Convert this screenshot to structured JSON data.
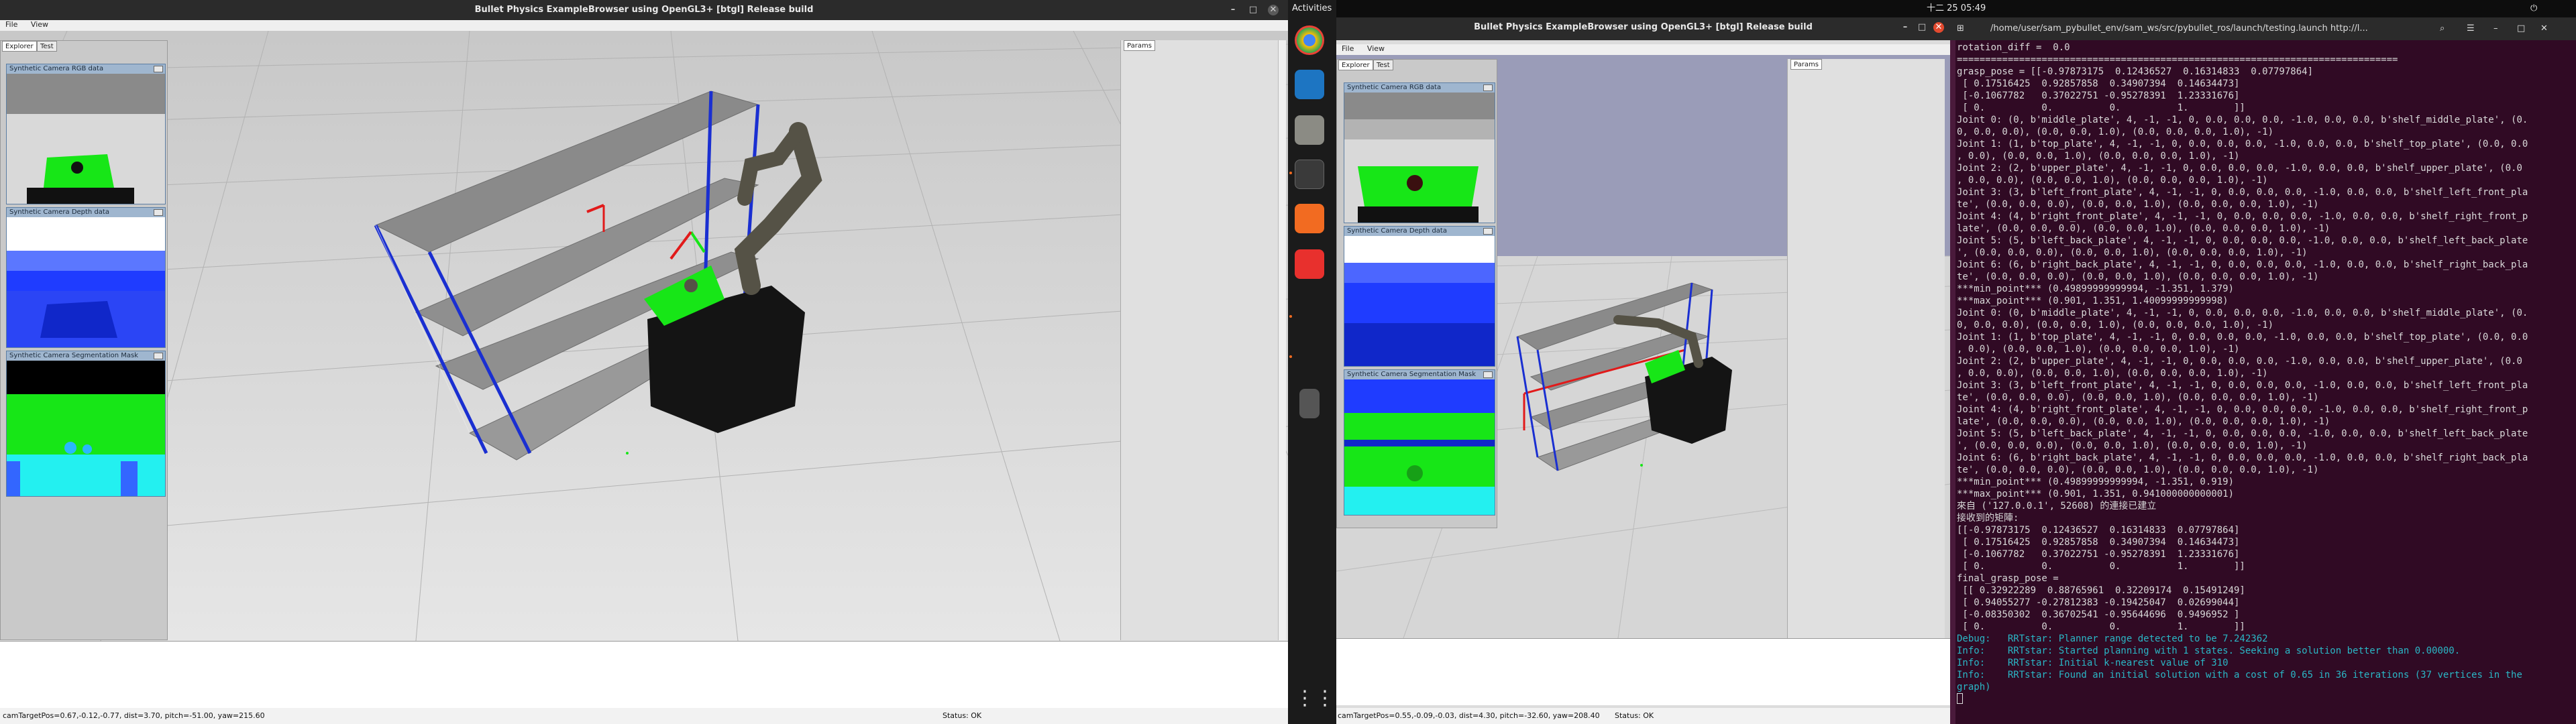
{
  "system": {
    "activities": "Activities",
    "clock": "十二 25  05:49"
  },
  "left_window": {
    "title": "Bullet Physics ExampleBrowser using OpenGL3+ [btgl] Release build",
    "menu": [
      "File",
      "View"
    ],
    "tabs": [
      "Explorer",
      "Test"
    ],
    "params_tab": "Params",
    "subwindows": [
      "Synthetic Camera RGB data",
      "Synthetic Camera Depth data",
      "Synthetic Camera Segmentation Mask"
    ],
    "status_left": "camTargetPos=0.67,-0.12,-0.77, dist=3.70, pitch=-51.00, yaw=215.60",
    "status_right": "Status: OK"
  },
  "right_window": {
    "title": "Bullet Physics ExampleBrowser using OpenGL3+ [btgl] Release build",
    "menu": [
      "File",
      "View"
    ],
    "tabs": [
      "Explorer",
      "Test"
    ],
    "params_tab": "Params",
    "subwindows": [
      "Synthetic Camera RGB data",
      "Synthetic Camera Depth data",
      "Synthetic Camera Segmentation Mask"
    ],
    "status_left": "camTargetPos=0.55,-0.09,-0.03, dist=4.30, pitch=-32.60, yaw=208.40",
    "status_right": "Status: OK"
  },
  "terminal": {
    "title": "/home/user/sam_pybullet_env/sam_ws/src/pybullet_ros/launch/testing.launch http://l...",
    "lines": [
      "rotation_diff =  0.0",
      "==============================================================================",
      "grasp_pose = [[-0.97873175  0.12436527  0.16314833  0.07797864]",
      " [ 0.17516425  0.92857858  0.34907394  0.14634473]",
      " [-0.1067782   0.37022751 -0.95278391  1.23331676]",
      " [ 0.          0.          0.          1.        ]]",
      "Joint 0: (0, b'middle_plate', 4, -1, -1, 0, 0.0, 0.0, 0.0, -1.0, 0.0, 0.0, b'shelf_middle_plate', (0.",
      "0, 0.0, 0.0), (0.0, 0.0, 1.0), (0.0, 0.0, 0.0, 1.0), -1)",
      "Joint 1: (1, b'top_plate', 4, -1, -1, 0, 0.0, 0.0, 0.0, -1.0, 0.0, 0.0, b'shelf_top_plate', (0.0, 0.0",
      ", 0.0), (0.0, 0.0, 1.0), (0.0, 0.0, 0.0, 1.0), -1)",
      "Joint 2: (2, b'upper_plate', 4, -1, -1, 0, 0.0, 0.0, 0.0, -1.0, 0.0, 0.0, b'shelf_upper_plate', (0.0",
      ", 0.0, 0.0), (0.0, 0.0, 1.0), (0.0, 0.0, 0.0, 1.0), -1)",
      "Joint 3: (3, b'left_front_plate', 4, -1, -1, 0, 0.0, 0.0, 0.0, -1.0, 0.0, 0.0, b'shelf_left_front_pla",
      "te', (0.0, 0.0, 0.0), (0.0, 0.0, 1.0), (0.0, 0.0, 0.0, 1.0), -1)",
      "Joint 4: (4, b'right_front_plate', 4, -1, -1, 0, 0.0, 0.0, 0.0, -1.0, 0.0, 0.0, b'shelf_right_front_p",
      "late', (0.0, 0.0, 0.0), (0.0, 0.0, 1.0), (0.0, 0.0, 0.0, 1.0), -1)",
      "Joint 5: (5, b'left_back_plate', 4, -1, -1, 0, 0.0, 0.0, 0.0, -1.0, 0.0, 0.0, b'shelf_left_back_plate",
      "', (0.0, 0.0, 0.0), (0.0, 0.0, 1.0), (0.0, 0.0, 0.0, 1.0), -1)",
      "Joint 6: (6, b'right_back_plate', 4, -1, -1, 0, 0.0, 0.0, 0.0, -1.0, 0.0, 0.0, b'shelf_right_back_pla",
      "te', (0.0, 0.0, 0.0), (0.0, 0.0, 1.0), (0.0, 0.0, 0.0, 1.0), -1)",
      "***min_point*** (0.49899999999994, -1.351, 1.379)",
      "***max_point*** (0.901, 1.351, 1.40099999999998)",
      "Joint 0: (0, b'middle_plate', 4, -1, -1, 0, 0.0, 0.0, 0.0, -1.0, 0.0, 0.0, b'shelf_middle_plate', (0.",
      "0, 0.0, 0.0), (0.0, 0.0, 1.0), (0.0, 0.0, 0.0, 1.0), -1)",
      "Joint 1: (1, b'top_plate', 4, -1, -1, 0, 0.0, 0.0, 0.0, -1.0, 0.0, 0.0, b'shelf_top_plate', (0.0, 0.0",
      ", 0.0), (0.0, 0.0, 1.0), (0.0, 0.0, 0.0, 1.0), -1)",
      "Joint 2: (2, b'upper_plate', 4, -1, -1, 0, 0.0, 0.0, 0.0, -1.0, 0.0, 0.0, b'shelf_upper_plate', (0.0",
      ", 0.0, 0.0), (0.0, 0.0, 1.0), (0.0, 0.0, 0.0, 1.0), -1)",
      "Joint 3: (3, b'left_front_plate', 4, -1, -1, 0, 0.0, 0.0, 0.0, -1.0, 0.0, 0.0, b'shelf_left_front_pla",
      "te', (0.0, 0.0, 0.0), (0.0, 0.0, 1.0), (0.0, 0.0, 0.0, 1.0), -1)",
      "Joint 4: (4, b'right_front_plate', 4, -1, -1, 0, 0.0, 0.0, 0.0, -1.0, 0.0, 0.0, b'shelf_right_front_p",
      "late', (0.0, 0.0, 0.0), (0.0, 0.0, 1.0), (0.0, 0.0, 0.0, 1.0), -1)",
      "Joint 5: (5, b'left_back_plate', 4, -1, -1, 0, 0.0, 0.0, 0.0, -1.0, 0.0, 0.0, b'shelf_left_back_plate",
      "', (0.0, 0.0, 0.0), (0.0, 0.0, 1.0), (0.0, 0.0, 0.0, 1.0), -1)",
      "Joint 6: (6, b'right_back_plate', 4, -1, -1, 0, 0.0, 0.0, 0.0, -1.0, 0.0, 0.0, b'shelf_right_back_pla",
      "te', (0.0, 0.0, 0.0), (0.0, 0.0, 1.0), (0.0, 0.0, 0.0, 1.0), -1)",
      "***min_point*** (0.49899999999994, -1.351, 0.919)",
      "***max_point*** (0.901, 1.351, 0.941000000000001)",
      "來自 ('127.0.0.1', 52608) 的連接已建立",
      "接收到的矩陣:",
      "[[-0.97873175  0.12436527  0.16314833  0.07797864]",
      " [ 0.17516425  0.92857858  0.34907394  0.14634473]",
      " [-0.1067782   0.37022751 -0.95278391  1.23331676]",
      " [ 0.          0.          0.          1.        ]]",
      "final_grasp_pose =",
      " [[ 0.32922289  0.88765961  0.32209174  0.15491249]",
      " [ 0.94055277 -0.27812383 -0.19425047  0.02699044]",
      " [-0.08350302  0.36702541 -0.95644696  0.9496952 ]",
      " [ 0.          0.          0.          1.        ]]"
    ],
    "log_lines": [
      "Debug:   RRTstar: Planner range detected to be 7.242362",
      "Info:    RRTstar: Started planning with 1 states. Seeking a solution better than 0.00000.",
      "Info:    RRTstar: Initial k-nearest value of 310",
      "Info:    RRTstar: Found an initial solution with a cost of 0.65 in 36 iterations (37 vertices in the",
      "graph)"
    ]
  },
  "colors": {
    "shelf_frame": "#1a2fd1",
    "plate": "#8a8a8a",
    "robot": "#555246",
    "base": "#141414",
    "target_green": "#17e617",
    "terminal_bg": "#300a24",
    "highlight_red": "#e11a1a"
  }
}
